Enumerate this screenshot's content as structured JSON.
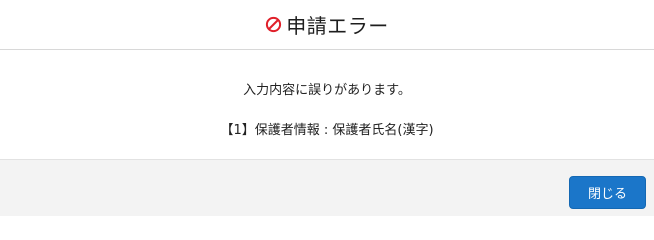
{
  "dialog": {
    "title": "申請エラー",
    "title_icon": "prohibited-icon",
    "error_color": "#e0202a",
    "message": "入力内容に誤りがあります。",
    "detail": "【1】保護者情報 : 保護者氏名(漢字)",
    "close_label": "閉じる",
    "accent_color": "#1b76c9"
  }
}
